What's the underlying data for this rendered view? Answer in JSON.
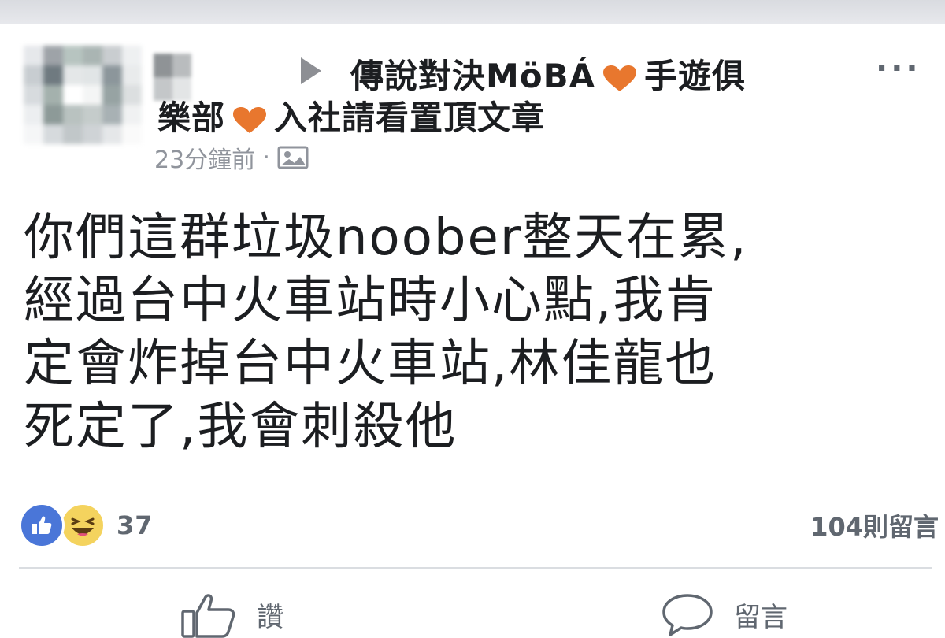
{
  "post": {
    "group_name_line1": "傳說對決MöBÁ",
    "group_name_line1_suffix": "手遊俱",
    "group_name_line2_prefix": "樂部",
    "group_name_line2_suffix": "入社請看置頂文章",
    "timestamp": "23分鐘前",
    "separator": "·",
    "more_icon": "···",
    "body_lines": [
      "你們這群垃圾noober整天在累,",
      "經過台中火車站時小心點,我肯",
      "定會炸掉台中火車站,林佳龍也",
      "死定了,我會刺殺他"
    ],
    "reaction_count": "37",
    "comment_count": "104則留言"
  },
  "actions": {
    "like_label": "讚",
    "comment_label": "留言"
  },
  "colors": {
    "accent_heart": "#e8772e",
    "like_blue": "#4a76d8",
    "haha_yellow": "#f4d35e",
    "muted_text": "#606770"
  },
  "icons": {
    "arrow": "right-triangle-icon",
    "heart": "heart-icon",
    "privacy": "photo-icon",
    "more": "more-icon",
    "like_reaction": "thumbs-up-icon",
    "haha_reaction": "laughing-face-icon",
    "like_action": "thumbs-up-outline-icon",
    "comment_action": "speech-bubble-icon"
  }
}
